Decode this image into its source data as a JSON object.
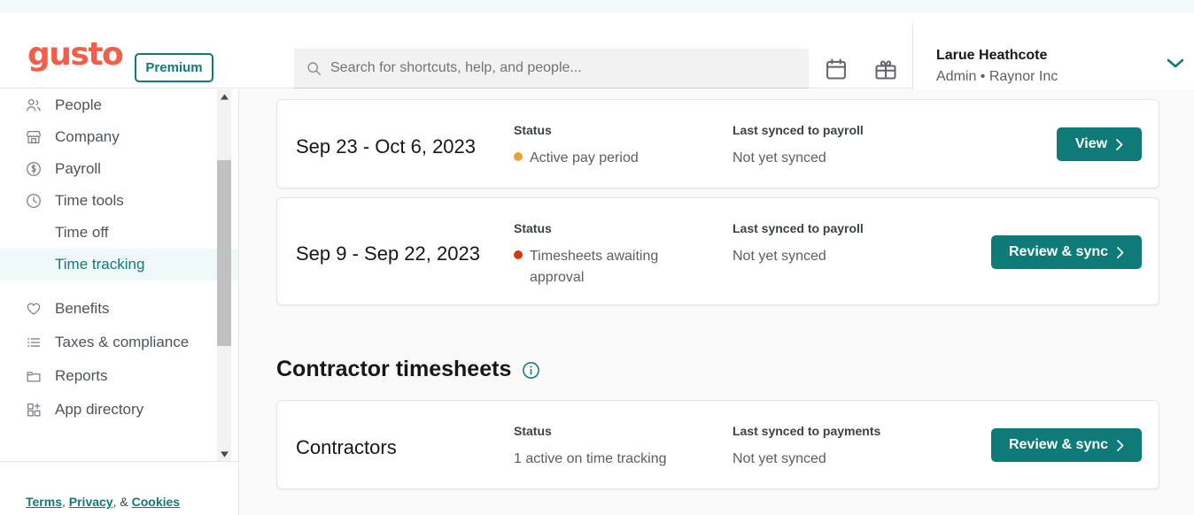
{
  "header": {
    "logo_text": "gusto",
    "premium_label": "Premium",
    "search": {
      "placeholder": "Search for shortcuts, help, and people...",
      "value": "",
      "icon": "search-icon"
    },
    "icons": [
      {
        "name": "calendar-icon"
      },
      {
        "name": "gift-icon"
      }
    ],
    "user": {
      "name": "Larue Heathcote",
      "role": "Admin • Raynor Inc",
      "caret": "chevron-down-icon"
    }
  },
  "sidebar": {
    "items": [
      {
        "label": "People",
        "icon": "people-icon",
        "sub": false,
        "active": false
      },
      {
        "label": "Company",
        "icon": "company-icon",
        "sub": false,
        "active": false
      },
      {
        "label": "Payroll",
        "icon": "payroll-icon",
        "sub": false,
        "active": false
      },
      {
        "label": "Time tools",
        "icon": "clock-icon",
        "sub": false,
        "active": false
      },
      {
        "label": "Time off",
        "icon": "",
        "sub": true,
        "active": false
      },
      {
        "label": "Time tracking",
        "icon": "",
        "sub": true,
        "active": true
      },
      {
        "label": "Benefits",
        "icon": "heart-icon",
        "sub": false,
        "active": false
      },
      {
        "label": "Taxes & compliance",
        "icon": "list-icon",
        "sub": false,
        "active": false
      },
      {
        "label": "Reports",
        "icon": "folder-icon",
        "sub": false,
        "active": false
      },
      {
        "label": "App directory",
        "icon": "app-grid-plus-icon",
        "sub": false,
        "active": false
      }
    ],
    "footer": {
      "terms": "Terms",
      "privacy": "Privacy",
      "cookies": "Cookies",
      "sep1": ", ",
      "sep2": ", & "
    }
  },
  "main": {
    "pay_period_cards": [
      {
        "period": "Sep 23 - Oct 6, 2023",
        "status_label": "Status",
        "status_value": "Active pay period",
        "status_dot_color": "#e5a33c",
        "sync_label": "Last synced to payroll",
        "sync_value": "Not yet synced",
        "button_label": "View"
      },
      {
        "period": "Sep 9 - Sep 22, 2023",
        "status_label": "Status",
        "status_value": "Timesheets awaiting approval",
        "status_dot_color": "#d9380f",
        "sync_label": "Last synced to payroll",
        "sync_value": "Not yet synced",
        "button_label": "Review & sync"
      }
    ],
    "contractor_section": {
      "title": "Contractor timesheets",
      "info_icon": "info-icon",
      "card": {
        "period": "Contractors",
        "status_label": "Status",
        "status_value": "1 active on time tracking",
        "sync_label": "Last synced to payments",
        "sync_value": "Not yet synced",
        "button_label": "Review & sync"
      }
    }
  },
  "colors": {
    "brand_coral": "#f45d48",
    "teal": "#0e7b78",
    "teal_accent": "#17a2a0",
    "amber": "#e5a33c",
    "red": "#d9380f"
  }
}
